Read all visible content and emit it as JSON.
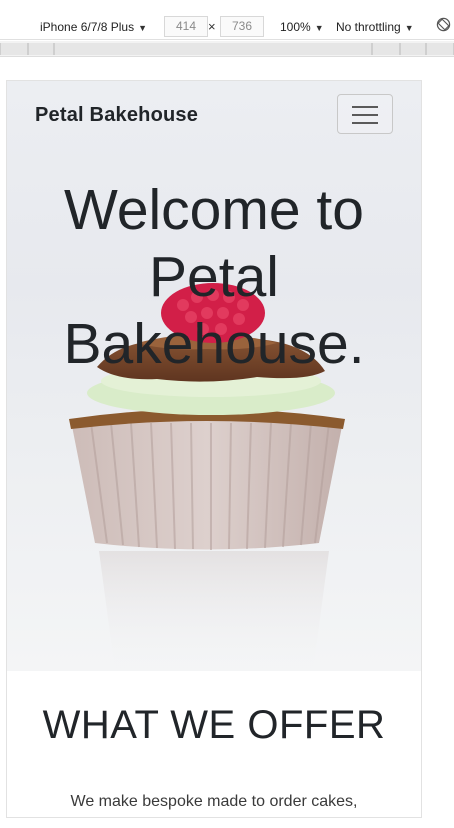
{
  "devtools": {
    "device": "iPhone 6/7/8 Plus",
    "width": "414",
    "height": "736",
    "times": "×",
    "zoom": "100%",
    "throttling": "No throttling",
    "caret": "▼"
  },
  "page": {
    "brand": "Petal Bakehouse",
    "hero": {
      "line1": "Welcome to",
      "line2": "Petal",
      "line3": "Bakehouse."
    },
    "offer": {
      "title": "WHAT WE OFFER",
      "text": "We make bespoke made to order cakes,"
    }
  },
  "colors": {
    "text": "#212529",
    "hero_bg": "#eceef2",
    "frosting_chocolate": "#7a4a2c",
    "frosting_mint": "#d8ebc9",
    "raspberry": "#d3204a",
    "liner": "#c9b7b4"
  },
  "icons": {
    "menu": "hamburger-menu-icon",
    "rotate": "rotate-icon"
  }
}
